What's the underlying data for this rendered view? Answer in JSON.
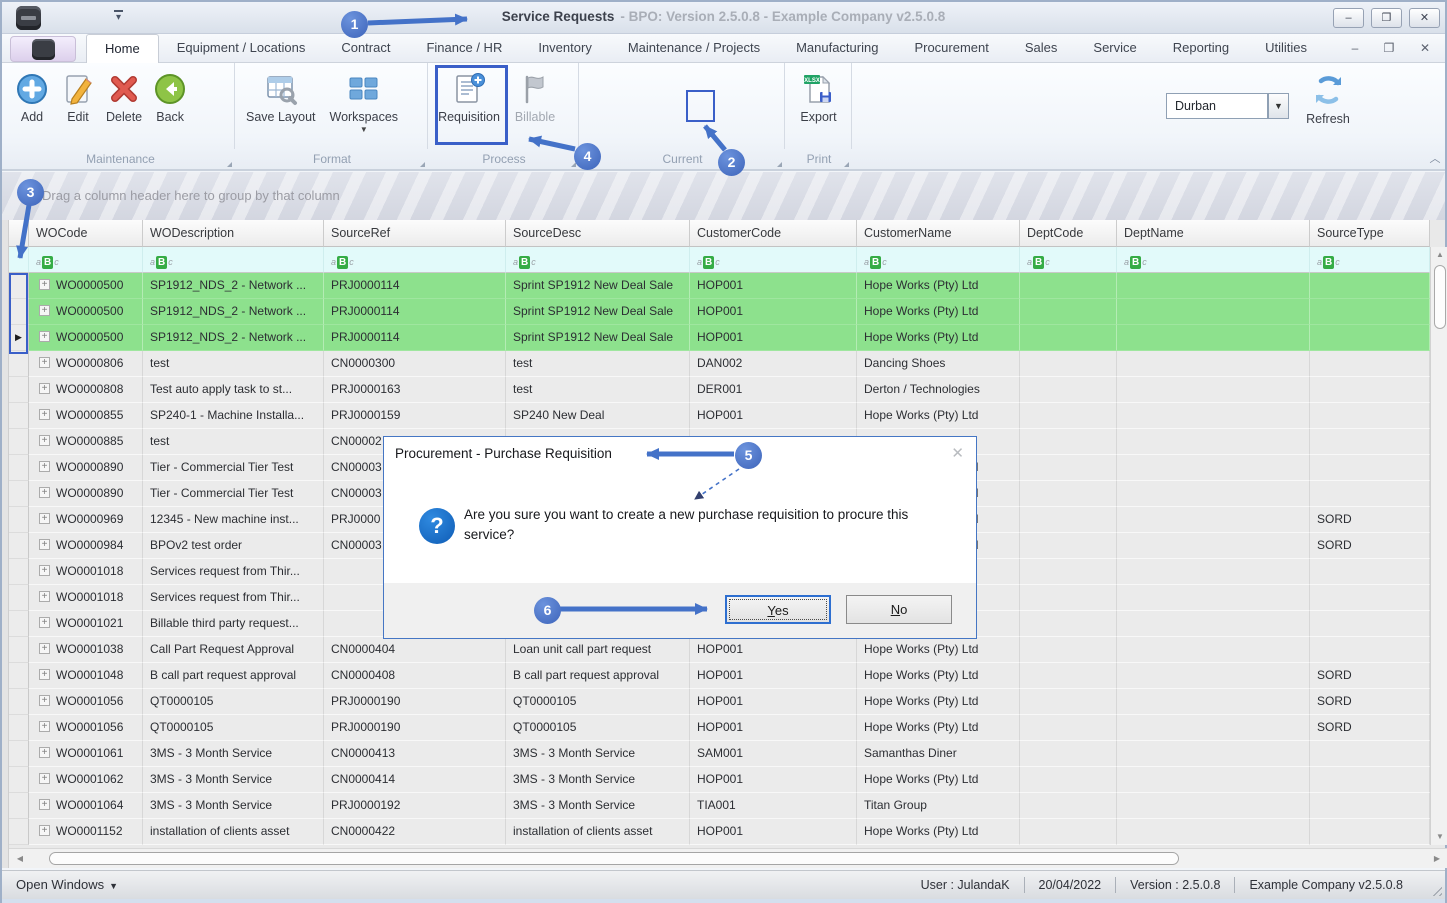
{
  "window": {
    "title": "Service Requests",
    "subtitle": "- BPO: Version 2.5.0.8 - Example Company v2.5.0.8",
    "min_glyph": "–",
    "max_glyph": "❐",
    "close_glyph": "✕"
  },
  "menu": {
    "tabs": [
      "Home",
      "Equipment / Locations",
      "Contract",
      "Finance / HR",
      "Inventory",
      "Maintenance / Projects",
      "Manufacturing",
      "Procurement",
      "Sales",
      "Service",
      "Reporting",
      "Utilities"
    ],
    "min_glyph": "–",
    "restore_glyph": "❐",
    "close_glyph": "✕"
  },
  "ribbon": {
    "groups": [
      {
        "label": "Maintenance",
        "buttons": [
          "Add",
          "Edit",
          "Delete",
          "Back"
        ]
      },
      {
        "label": "Format",
        "buttons": [
          "Save Layout",
          "Workspaces"
        ]
      },
      {
        "label": "Process",
        "buttons": [
          "Requisition",
          "Billable"
        ]
      },
      {
        "label": "Current",
        "combo_value": "Durban",
        "buttons": [
          "Refresh"
        ]
      },
      {
        "label": "Print",
        "buttons": [
          "Export"
        ]
      }
    ],
    "export_badge": "XLSX"
  },
  "grid": {
    "group_hint": "Drag a column header here to group by that column",
    "columns": [
      "WOCode",
      "WODescription",
      "SourceRef",
      "SourceDesc",
      "CustomerCode",
      "CustomerName",
      "DeptCode",
      "DeptName",
      "SourceType"
    ],
    "filter_icon": [
      "a",
      "B",
      "c"
    ],
    "rows": [
      {
        "green": true,
        "indicator": false,
        "cells": [
          "WO0000500",
          "SP1912_NDS_2 - Network ...",
          "PRJ0000114",
          "Sprint SP1912 New Deal Sale",
          "HOP001",
          "Hope Works (Pty) Ltd",
          "",
          "",
          ""
        ]
      },
      {
        "green": true,
        "indicator": false,
        "cells": [
          "WO0000500",
          "SP1912_NDS_2 - Network ...",
          "PRJ0000114",
          "Sprint SP1912 New Deal Sale",
          "HOP001",
          "Hope Works (Pty) Ltd",
          "",
          "",
          ""
        ]
      },
      {
        "green": true,
        "indicator": true,
        "cells": [
          "WO0000500",
          "SP1912_NDS_2 - Network ...",
          "PRJ0000114",
          "Sprint SP1912 New Deal Sale",
          "HOP001",
          "Hope Works (Pty) Ltd",
          "",
          "",
          ""
        ]
      },
      {
        "green": false,
        "indicator": false,
        "cells": [
          "WO0000806",
          "test",
          "CN0000300",
          "test",
          "DAN002",
          "Dancing Shoes",
          "",
          "",
          ""
        ]
      },
      {
        "green": false,
        "indicator": false,
        "cells": [
          "WO0000808",
          "Test auto apply task to st...",
          "PRJ0000163",
          "test",
          "DER001",
          "Derton / Technologies",
          "",
          "",
          ""
        ]
      },
      {
        "green": false,
        "indicator": false,
        "cells": [
          "WO0000855",
          "SP240-1 - Machine Installa...",
          "PRJ0000159",
          "SP240 New Deal",
          "HOP001",
          "Hope Works (Pty) Ltd",
          "",
          "",
          ""
        ]
      },
      {
        "green": false,
        "indicator": false,
        "cells": [
          "WO0000885",
          "test",
          "CN00002",
          "",
          "",
          "",
          "",
          "",
          ""
        ]
      },
      {
        "green": false,
        "indicator": false,
        "cells": [
          "WO0000890",
          "Tier - Commercial Tier Test",
          "CN00003",
          "",
          "",
          "Hope Works (Pty) Ltd",
          "",
          "",
          ""
        ]
      },
      {
        "green": false,
        "indicator": false,
        "cells": [
          "WO0000890",
          "Tier - Commercial Tier Test",
          "CN00003",
          "",
          "",
          "Hope Works (Pty) Ltd",
          "",
          "",
          ""
        ]
      },
      {
        "green": false,
        "indicator": false,
        "cells": [
          "WO0000969",
          "12345 - New machine inst...",
          "PRJ0000",
          "",
          "",
          "Hope Works (Pty) Ltd",
          "",
          "",
          "SORD"
        ]
      },
      {
        "green": false,
        "indicator": false,
        "cells": [
          "WO0000984",
          "BPOv2 test order",
          "CN00003",
          "",
          "",
          "Hope Works (Pty) Ltd",
          "",
          "",
          "SORD"
        ]
      },
      {
        "green": false,
        "indicator": false,
        "cells": [
          "WO0001018",
          "Services request from Thir...",
          "",
          "",
          "",
          "",
          "",
          "",
          ""
        ]
      },
      {
        "green": false,
        "indicator": false,
        "cells": [
          "WO0001018",
          "Services request from Thir...",
          "",
          "",
          "",
          "",
          "",
          "",
          ""
        ]
      },
      {
        "green": false,
        "indicator": false,
        "cells": [
          "WO0001021",
          "Billable third party request...",
          "",
          "",
          "",
          "",
          "",
          "",
          ""
        ]
      },
      {
        "green": false,
        "indicator": false,
        "cells": [
          "WO0001038",
          "Call Part Request Approval",
          "CN0000404",
          "Loan unit call part request",
          "HOP001",
          "Hope Works (Pty) Ltd",
          "",
          "",
          ""
        ]
      },
      {
        "green": false,
        "indicator": false,
        "cells": [
          "WO0001048",
          "B call part request approval",
          "CN0000408",
          "B call part request approval",
          "HOP001",
          "Hope Works (Pty) Ltd",
          "",
          "",
          "SORD"
        ]
      },
      {
        "green": false,
        "indicator": false,
        "cells": [
          "WO0001056",
          "QT0000105",
          "PRJ0000190",
          "QT0000105",
          "HOP001",
          "Hope Works (Pty) Ltd",
          "",
          "",
          "SORD"
        ]
      },
      {
        "green": false,
        "indicator": false,
        "cells": [
          "WO0001056",
          "QT0000105",
          "PRJ0000190",
          "QT0000105",
          "HOP001",
          "Hope Works (Pty) Ltd",
          "",
          "",
          "SORD"
        ]
      },
      {
        "green": false,
        "indicator": false,
        "cells": [
          "WO0001061",
          "3MS - 3 Month Service",
          "CN0000413",
          "3MS - 3 Month Service",
          "SAM001",
          "Samanthas Diner",
          "",
          "",
          ""
        ]
      },
      {
        "green": false,
        "indicator": false,
        "cells": [
          "WO0001062",
          "3MS - 3 Month Service",
          "CN0000414",
          "3MS - 3 Month Service",
          "HOP001",
          "Hope Works (Pty) Ltd",
          "",
          "",
          ""
        ]
      },
      {
        "green": false,
        "indicator": false,
        "cells": [
          "WO0001064",
          "3MS - 3 Month Service",
          "PRJ0000192",
          "3MS - 3 Month Service",
          "TIA001",
          "Titan Group",
          "",
          "",
          ""
        ]
      },
      {
        "green": false,
        "indicator": false,
        "cells": [
          "WO0001152",
          "installation of clients asset",
          "CN0000422",
          "installation of clients asset",
          "HOP001",
          "Hope Works (Pty) Ltd",
          "",
          "",
          ""
        ]
      }
    ]
  },
  "dialog": {
    "title": "Procurement - Purchase Requisition",
    "message": "Are you sure you want to create a new purchase requisition to procure this service?",
    "help_glyph": "?",
    "close_glyph": "✕",
    "yes_label": "Yes",
    "no_label": "No"
  },
  "statusbar": {
    "open_windows": "Open Windows",
    "user": "User : JulandaK",
    "date": "20/04/2022",
    "version": "Version : 2.5.0.8",
    "company": "Example Company v2.5.0.8"
  },
  "callouts": [
    "1",
    "2",
    "3",
    "4",
    "5",
    "6"
  ]
}
